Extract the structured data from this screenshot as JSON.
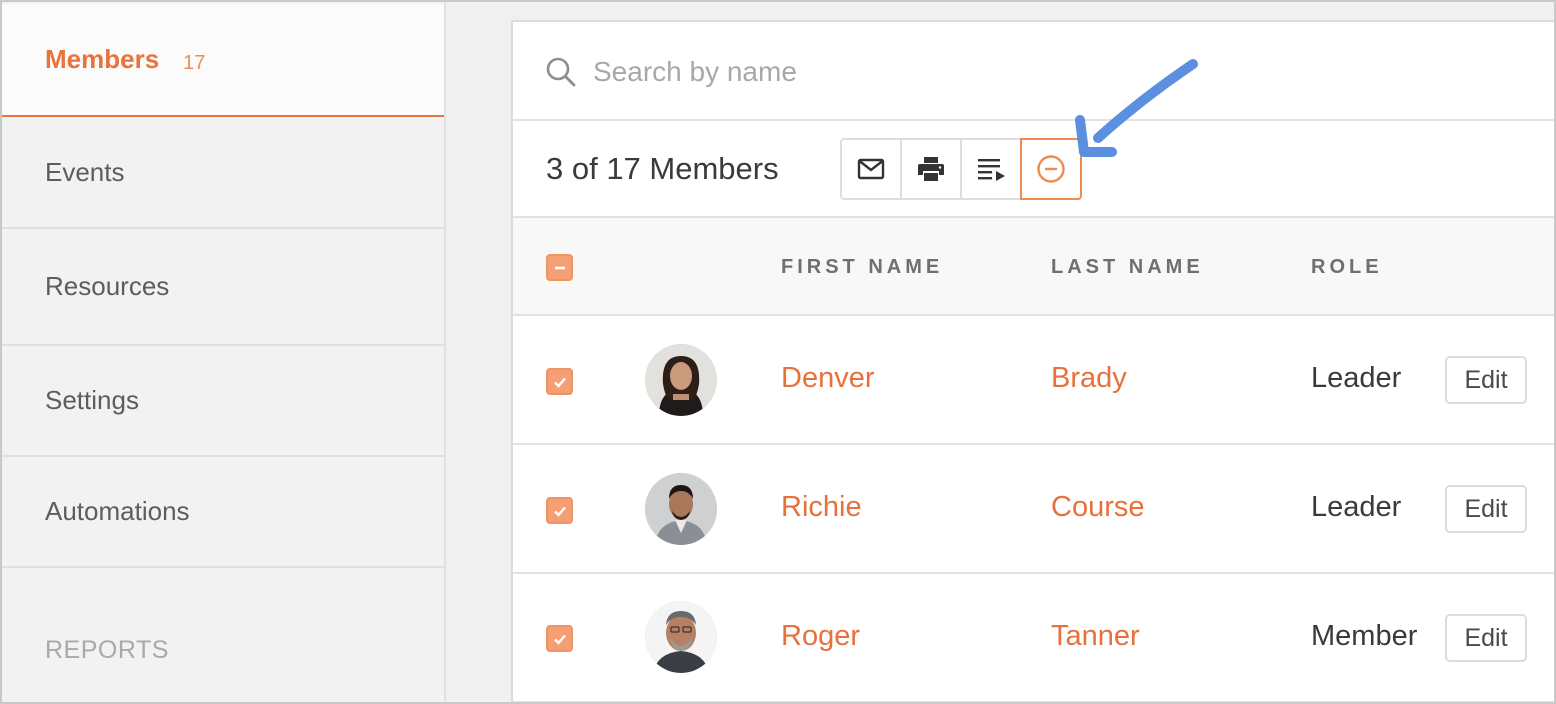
{
  "sidebar": {
    "items": [
      {
        "label": "Members",
        "count": "17"
      },
      {
        "label": "Events"
      },
      {
        "label": "Resources"
      },
      {
        "label": "Settings"
      },
      {
        "label": "Automations"
      }
    ],
    "section_label": "REPORTS"
  },
  "search": {
    "placeholder": "Search by name",
    "icon": "search-icon"
  },
  "toolbar": {
    "count_label": "3 of 17 Members",
    "buttons": [
      "email-icon",
      "print-icon",
      "playlist-icon",
      "remove-circle-icon"
    ]
  },
  "table": {
    "columns": [
      "FIRST NAME",
      "LAST NAME",
      "ROLE"
    ],
    "rows": [
      {
        "first": "Denver",
        "last": "Brady",
        "role": "Leader",
        "edit": "Edit",
        "checked": true
      },
      {
        "first": "Richie",
        "last": "Course",
        "role": "Leader",
        "edit": "Edit",
        "checked": true
      },
      {
        "first": "Roger",
        "last": "Tanner",
        "role": "Member",
        "edit": "Edit",
        "checked": true
      }
    ]
  },
  "colors": {
    "accent": "#e8743b",
    "checkbox": "#f4a074",
    "annotation_arrow": "#5b8fe0"
  }
}
